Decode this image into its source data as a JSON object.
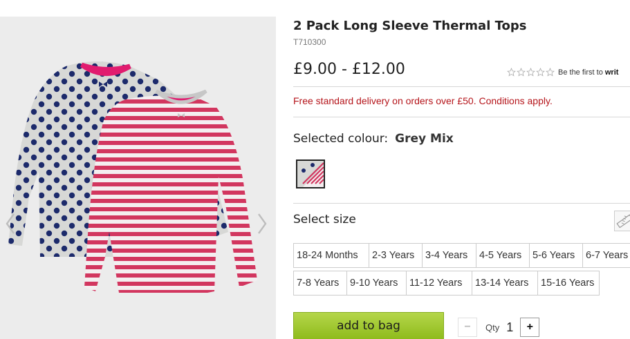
{
  "product": {
    "title": "2 Pack Long Sleeve Thermal Tops",
    "sku": "T710300",
    "price": "£9.00 - £12.00",
    "rating": {
      "stars_filled": 0,
      "stars_total": 5,
      "prompt": "Be the first to",
      "link": "writ"
    },
    "delivery_message": "Free standard delivery on orders over £50. Conditions apply."
  },
  "colour": {
    "label": "Selected colour:",
    "value": "Grey Mix"
  },
  "size": {
    "label": "Select size",
    "rows": [
      [
        "18-24 Months",
        "2-3 Years",
        "3-4 Years",
        "4-5 Years",
        "5-6 Years",
        "6-7 Years"
      ],
      [
        "7-8 Years",
        "9-10 Years",
        "11-12 Years",
        "13-14 Years",
        "15-16 Years"
      ]
    ]
  },
  "actions": {
    "add_to_bag": "add to bag",
    "qty_label": "Qty",
    "qty_value": "1",
    "minus": "−",
    "plus": "+"
  },
  "colors": {
    "delivery_red": "#b5151b",
    "stripe_pink": "#d2365f",
    "dot_navy": "#1c2a6b",
    "add_bag_green": "#9bc42e"
  },
  "icons": [
    "chevron-left-icon",
    "chevron-right-icon",
    "star-icon",
    "ruler-icon",
    "minus-icon",
    "plus-icon"
  ]
}
